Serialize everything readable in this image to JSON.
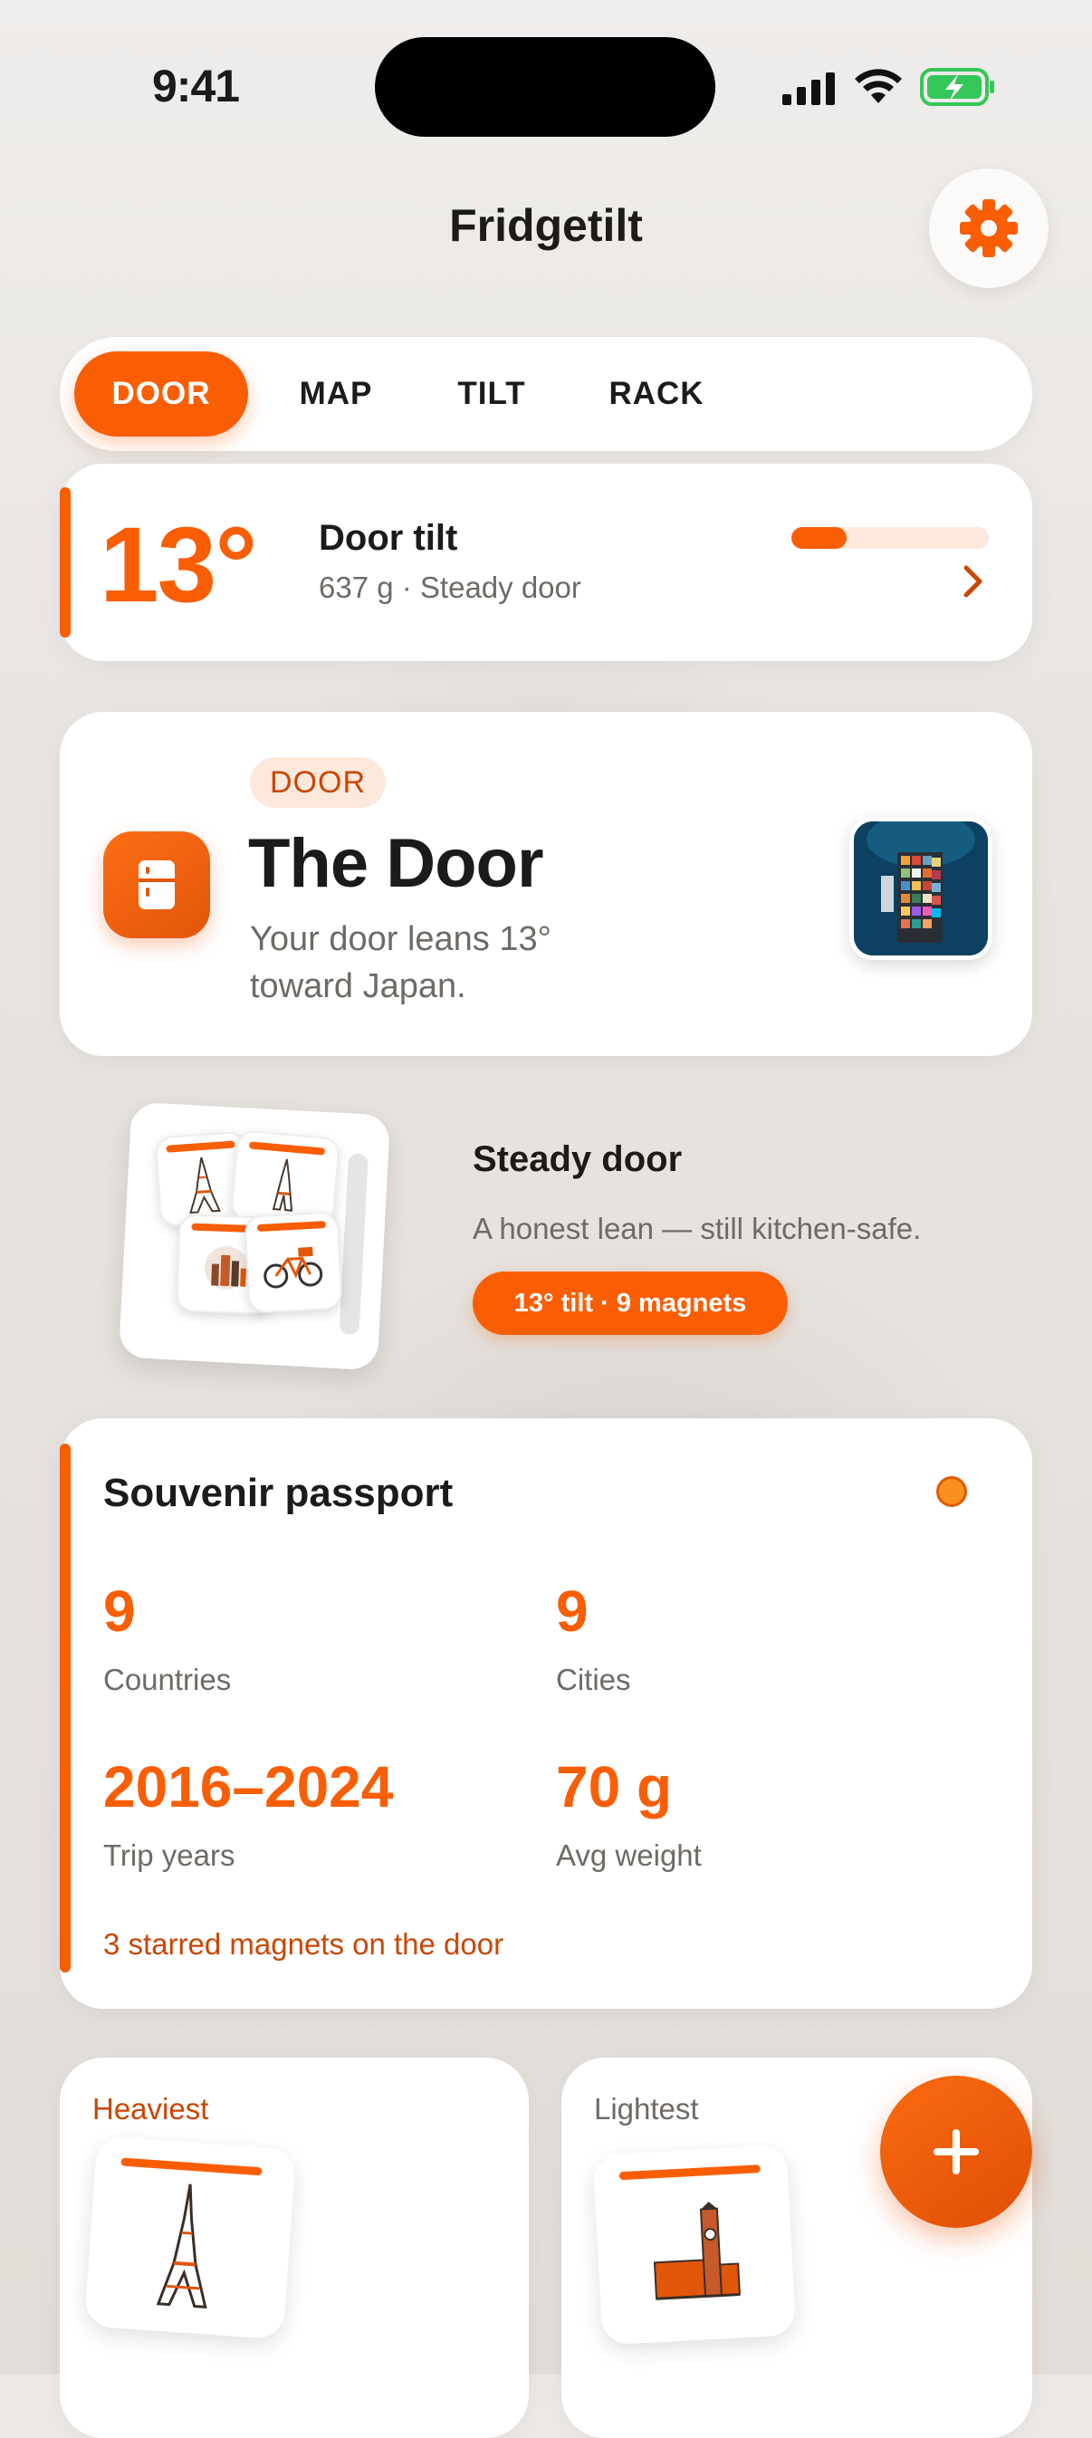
{
  "status_bar": {
    "time": "9:41"
  },
  "header": {
    "title": "Fridgetilt",
    "settings_icon": "gear-icon"
  },
  "tabs": [
    {
      "label": "DOOR",
      "active": true
    },
    {
      "label": "MAP",
      "active": false
    },
    {
      "label": "TILT",
      "active": false
    },
    {
      "label": "RACK",
      "active": false
    }
  ],
  "tilt_card": {
    "angle": "13°",
    "title": "Door tilt",
    "subtitle": "637 g · Steady door",
    "progress": 0.28
  },
  "door_card": {
    "tag": "DOOR",
    "title": "The Door",
    "description_line1": "Your door leans 13°",
    "description_line2": "toward Japan."
  },
  "steady": {
    "title": "Steady door",
    "subtitle": "A honest lean — still kitchen-safe.",
    "chip": "13° tilt · 9 magnets"
  },
  "passport": {
    "title": "Souvenir passport",
    "stats": [
      {
        "value": "9",
        "label": "Countries"
      },
      {
        "value": "9",
        "label": "Cities"
      },
      {
        "value": "2016–2024",
        "label": "Trip years"
      },
      {
        "value": "70 g",
        "label": "Avg weight"
      }
    ],
    "footer": "3 starred magnets on the door"
  },
  "extremes": {
    "heaviest_label": "Heaviest",
    "lightest_label": "Lightest"
  },
  "colors": {
    "accent": "#fa5e05",
    "accent_soft": "#fde8dc",
    "text": "#1d1b19",
    "muted": "#6f6a65"
  }
}
